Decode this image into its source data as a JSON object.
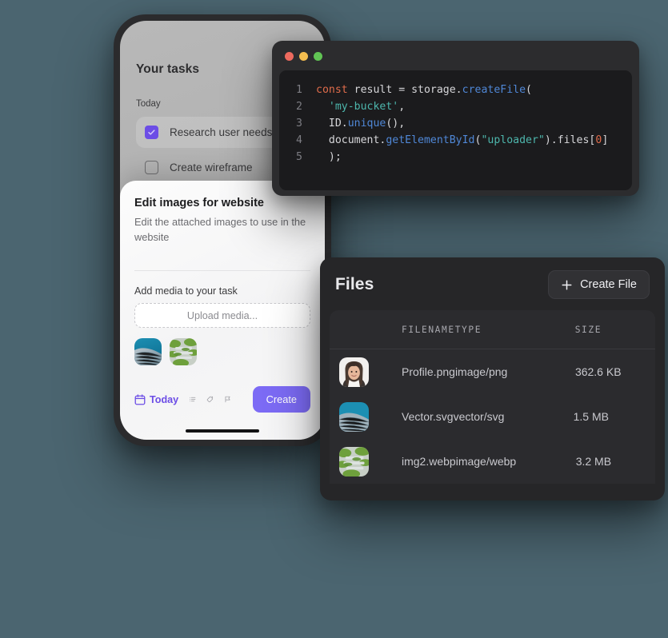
{
  "background_color": "#4b6570",
  "accent_purple": "#7c6bf5",
  "phone": {
    "tasks": {
      "title": "Your tasks",
      "section_label": "Today",
      "items": [
        {
          "label": "Research user needs",
          "checked": true
        },
        {
          "label": "Create wireframe",
          "checked": false
        }
      ]
    },
    "sheet": {
      "title": "Edit images for website",
      "description": "Edit the attached images to use in the website",
      "media_label": "Add media to your task",
      "upload_placeholder": "Upload media...",
      "thumbnails": [
        {
          "name": "vector-thumbnail"
        },
        {
          "name": "building-thumbnail"
        }
      ],
      "toolbar": {
        "today_label": "Today",
        "icons": [
          "calendar-icon",
          "list-icon",
          "tag-icon",
          "flag-icon"
        ]
      },
      "create_label": "Create"
    }
  },
  "code_window": {
    "traffic_lights": [
      "#ed6a5e",
      "#f4bd4f",
      "#61c454"
    ],
    "lines": [
      {
        "num": "1",
        "tokens": [
          {
            "t": "const",
            "c": "kw"
          },
          {
            "t": " result = storage.",
            "c": "pl"
          },
          {
            "t": "createFile",
            "c": "fn"
          },
          {
            "t": "(",
            "c": "pl"
          }
        ]
      },
      {
        "num": "2",
        "tokens": [
          {
            "t": "  ",
            "c": "pl"
          },
          {
            "t": "'my-bucket'",
            "c": "str"
          },
          {
            "t": ",",
            "c": "pl"
          }
        ]
      },
      {
        "num": "3",
        "tokens": [
          {
            "t": "  ID.",
            "c": "pl"
          },
          {
            "t": "unique",
            "c": "fn"
          },
          {
            "t": "(),",
            "c": "pl"
          }
        ]
      },
      {
        "num": "4",
        "tokens": [
          {
            "t": "  document.",
            "c": "pl"
          },
          {
            "t": "getElementById",
            "c": "fn"
          },
          {
            "t": "(",
            "c": "pl"
          },
          {
            "t": "\"uploader\"",
            "c": "str"
          },
          {
            "t": ").files[",
            "c": "pl"
          },
          {
            "t": "0",
            "c": "num"
          },
          {
            "t": "]",
            "c": "pl"
          }
        ]
      },
      {
        "num": "5",
        "tokens": [
          {
            "t": "  );",
            "c": "pl"
          }
        ]
      }
    ]
  },
  "files_panel": {
    "title": "Files",
    "create_file_label": "Create File",
    "columns": [
      "FILENAME",
      "TYPE",
      "SIZE"
    ],
    "rows": [
      {
        "thumb": "profile-photo-thumbnail",
        "filename": "Profile.png",
        "type": "image/png",
        "size": "362.6 KB"
      },
      {
        "thumb": "vector-thumbnail",
        "filename": "Vector.svg",
        "type": "vector/svg",
        "size": "1.5 MB"
      },
      {
        "thumb": "building-thumbnail",
        "filename": "img2.webp",
        "type": "image/webp",
        "size": "3.2 MB"
      }
    ]
  }
}
